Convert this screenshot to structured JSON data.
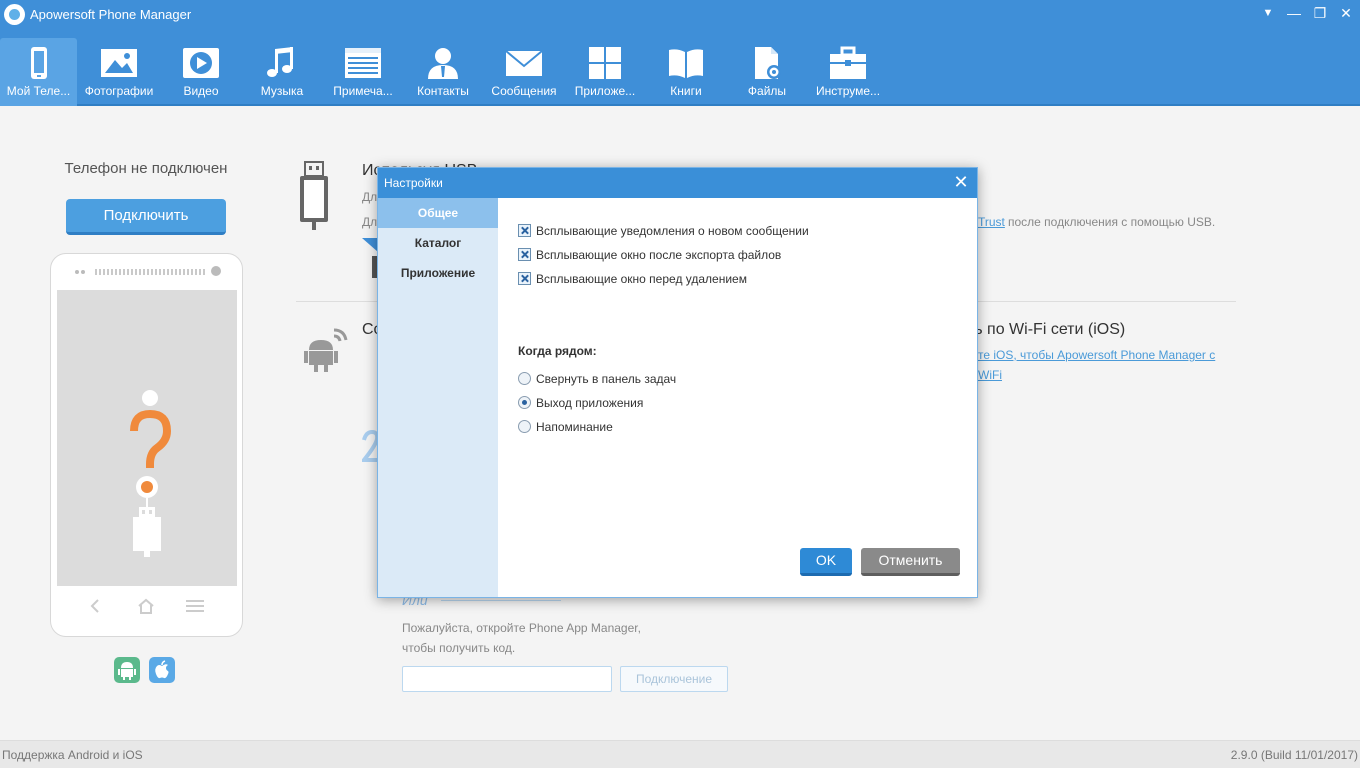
{
  "app": {
    "title": "Apowersoft Phone Manager"
  },
  "window_controls": {
    "menu": "▼",
    "minimize": "—",
    "maximize": "❐",
    "close": "✕"
  },
  "toolbar": {
    "items": [
      {
        "label": "Мой Теле...",
        "icon": "phone-icon"
      },
      {
        "label": "Фотографии",
        "icon": "photo-icon"
      },
      {
        "label": "Видео",
        "icon": "video-icon"
      },
      {
        "label": "Музыка",
        "icon": "music-icon"
      },
      {
        "label": "Примеча...",
        "icon": "notes-icon"
      },
      {
        "label": "Контакты",
        "icon": "contacts-icon"
      },
      {
        "label": "Сообщения",
        "icon": "messages-icon"
      },
      {
        "label": "Приложе...",
        "icon": "apps-icon"
      },
      {
        "label": "Книги",
        "icon": "books-icon"
      },
      {
        "label": "Файлы",
        "icon": "files-icon"
      },
      {
        "label": "Инструме...",
        "icon": "tools-icon"
      }
    ]
  },
  "left_panel": {
    "status": "Телефон не подключен",
    "connect_label": "Подключить"
  },
  "main": {
    "usb_title": "Используя USB",
    "usb_line1": "Дл",
    "usb_line2": "Дл",
    "usb_trust_link": "Trust",
    "usb_trust_after": "после подключения с помощью USB.",
    "wifi_partial_title": "Со",
    "wifi_title": "ить по Wi-Fi сети (iOS)",
    "wifi_link_line1": "те iOS, чтобы Apowersoft Phone Manager с",
    "wifi_link_line2": "WiFi",
    "or_label": "Или",
    "hint_line1": "Пожалуйста, откройте Phone App Manager,",
    "hint_line2": "чтобы получить код.",
    "code_connect_label": "Подключение"
  },
  "dialog": {
    "title": "Настройки",
    "close": "✕",
    "sidebar": [
      {
        "label": "Общее",
        "active": true
      },
      {
        "label": "Каталог",
        "active": false
      },
      {
        "label": "Приложение",
        "active": false
      }
    ],
    "checkboxes": [
      {
        "label": "Всплывающие уведомления о новом сообщении",
        "checked": true
      },
      {
        "label": "Всплывающие окно после экспорта файлов",
        "checked": true
      },
      {
        "label": "Всплывающие окно перед удалением",
        "checked": true
      }
    ],
    "near_label": "Когда рядом:",
    "radios": [
      {
        "label": "Свернуть в панель задач",
        "selected": false
      },
      {
        "label": "Выход приложения",
        "selected": true
      },
      {
        "label": "Напоминание",
        "selected": false
      }
    ],
    "ok_label": "OK",
    "cancel_label": "Отменить"
  },
  "footer": {
    "left": "Поддержка Android и iOS",
    "right": "2.9.0 (Build 11/01/2017)"
  },
  "colors": {
    "brand_blue": "#3f8fd8",
    "accent_orange": "#f08a3c",
    "android_green": "#5bb98c",
    "ios_blue": "#5aa9e6"
  }
}
